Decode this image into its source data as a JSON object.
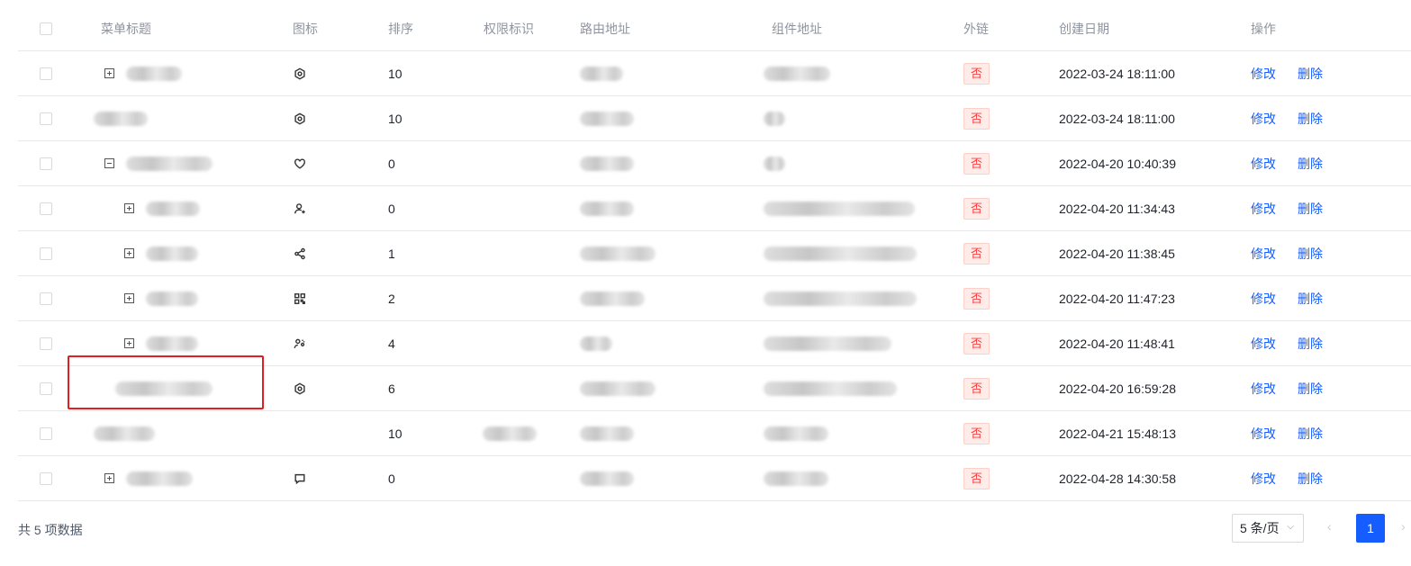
{
  "headers": {
    "title": "菜单标题",
    "icon": "图标",
    "order": "排序",
    "perm": "权限标识",
    "route": "路由地址",
    "component": "组件地址",
    "external": "外链",
    "created": "创建日期",
    "actions": "操作"
  },
  "rows": [
    {
      "expander": "plus",
      "indent": 0,
      "title": "",
      "icon": "setting-icon",
      "order": "10",
      "perm": "",
      "route": "",
      "component": "",
      "external": "否",
      "created": "2022-03-24 18:11:00",
      "edit": "修改",
      "delete": "删除"
    },
    {
      "expander": "none",
      "indent": 0,
      "title": "",
      "icon": "setting-icon",
      "order": "10",
      "perm": "",
      "route": "",
      "component": "",
      "external": "否",
      "created": "2022-03-24 18:11:00",
      "edit": "修改",
      "delete": "删除"
    },
    {
      "expander": "minus",
      "indent": 0,
      "title": "",
      "icon": "heart-icon",
      "order": "0",
      "perm": "",
      "route": "",
      "component": "",
      "external": "否",
      "created": "2022-04-20 10:40:39",
      "edit": "修改",
      "delete": "删除"
    },
    {
      "expander": "plus",
      "indent": 1,
      "title": "",
      "icon": "user-add-icon",
      "order": "0",
      "perm": "",
      "route": "",
      "component": "",
      "external": "否",
      "created": "2022-04-20 11:34:43",
      "edit": "修改",
      "delete": "删除"
    },
    {
      "expander": "plus",
      "indent": 1,
      "title": "",
      "icon": "share-icon",
      "order": "1",
      "perm": "",
      "route": "",
      "component": "",
      "external": "否",
      "created": "2022-04-20 11:38:45",
      "edit": "修改",
      "delete": "删除"
    },
    {
      "expander": "plus",
      "indent": 1,
      "title": "",
      "icon": "qrcode-icon",
      "order": "2",
      "perm": "",
      "route": "",
      "component": "",
      "external": "否",
      "created": "2022-04-20 11:47:23",
      "edit": "修改",
      "delete": "删除"
    },
    {
      "expander": "plus",
      "indent": 1,
      "title": "",
      "icon": "users-icon",
      "order": "4",
      "perm": "",
      "route": "",
      "component": "",
      "external": "否",
      "created": "2022-04-20 11:48:41",
      "edit": "修改",
      "delete": "删除"
    },
    {
      "expander": "none",
      "indent": 1,
      "title": "",
      "icon": "setting-icon",
      "order": "6",
      "perm": "",
      "route": "",
      "component": "",
      "external": "否",
      "created": "2022-04-20 16:59:28",
      "edit": "修改",
      "delete": "删除"
    },
    {
      "expander": "none",
      "indent": 0,
      "title": "",
      "icon": "",
      "order": "10",
      "perm": "",
      "route": "",
      "component": "",
      "external": "否",
      "created": "2022-04-21 15:48:13",
      "edit": "修改",
      "delete": "删除"
    },
    {
      "expander": "plus",
      "indent": 0,
      "title": "",
      "icon": "message-icon",
      "order": "0",
      "perm": "",
      "route": "",
      "component": "",
      "external": "否",
      "created": "2022-04-28 14:30:58",
      "edit": "修改",
      "delete": "删除"
    }
  ],
  "footer": {
    "total": "共 5 项数据",
    "page_size": "5 条/页",
    "current_page": "1"
  },
  "colors": {
    "accent": "#165dff",
    "danger": "#f53f3f",
    "highlight": "#e02020"
  }
}
